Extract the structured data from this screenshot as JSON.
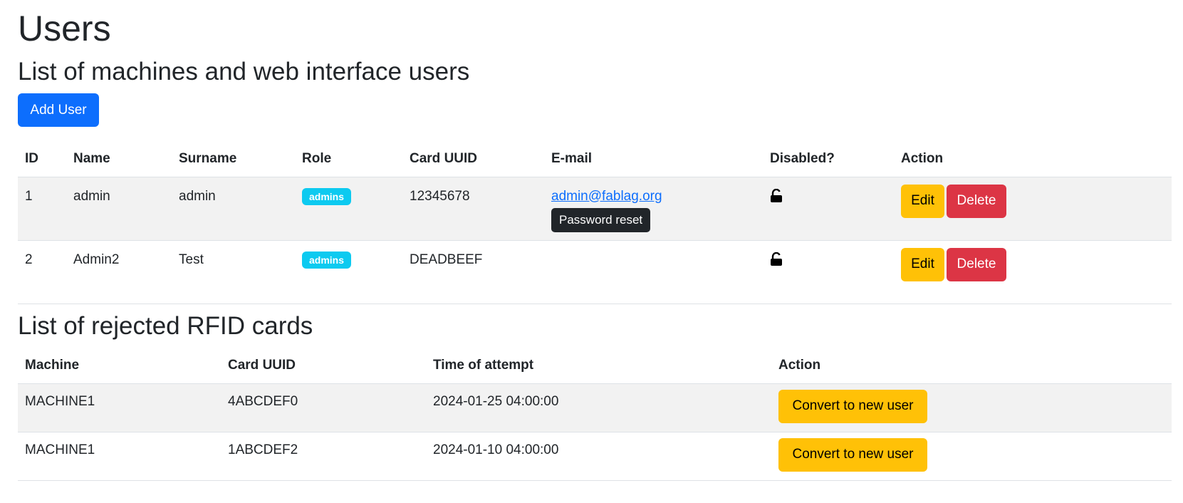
{
  "page": {
    "title": "Users",
    "users_subtitle": "List of machines and web interface users",
    "add_user_label": "Add User",
    "rejected_subtitle": "List of rejected RFID cards"
  },
  "users_table": {
    "headers": [
      "ID",
      "Name",
      "Surname",
      "Role",
      "Card UUID",
      "E-mail",
      "Disabled?",
      "Action"
    ],
    "rows": [
      {
        "id": "1",
        "name": "admin",
        "surname": "admin",
        "role": "admins",
        "card_uuid": "12345678",
        "email": "admin@fablag.org",
        "tooltip": "Password reset",
        "disabled_icon": "unlock-icon",
        "edit": "Edit",
        "delete": "Delete"
      },
      {
        "id": "2",
        "name": "Admin2",
        "surname": "Test",
        "role": "admins",
        "card_uuid": "DEADBEEF",
        "email": "",
        "tooltip": "",
        "disabled_icon": "unlock-icon",
        "edit": "Edit",
        "delete": "Delete"
      }
    ]
  },
  "rejected_table": {
    "headers": [
      "Machine",
      "Card UUID",
      "Time of attempt",
      "Action"
    ],
    "rows": [
      {
        "machine": "MACHINE1",
        "card_uuid": "4ABCDEF0",
        "time": "2024-01-25 04:00:00",
        "action": "Convert to new user"
      },
      {
        "machine": "MACHINE1",
        "card_uuid": "1ABCDEF2",
        "time": "2024-01-10 04:00:00",
        "action": "Convert to new user"
      }
    ]
  },
  "colors": {
    "primary": "#0d6efd",
    "warning": "#ffc107",
    "danger": "#dc3545",
    "info_badge": "#0dcaf0",
    "tooltip_bg": "#212529",
    "stripe": "#f2f2f2"
  }
}
